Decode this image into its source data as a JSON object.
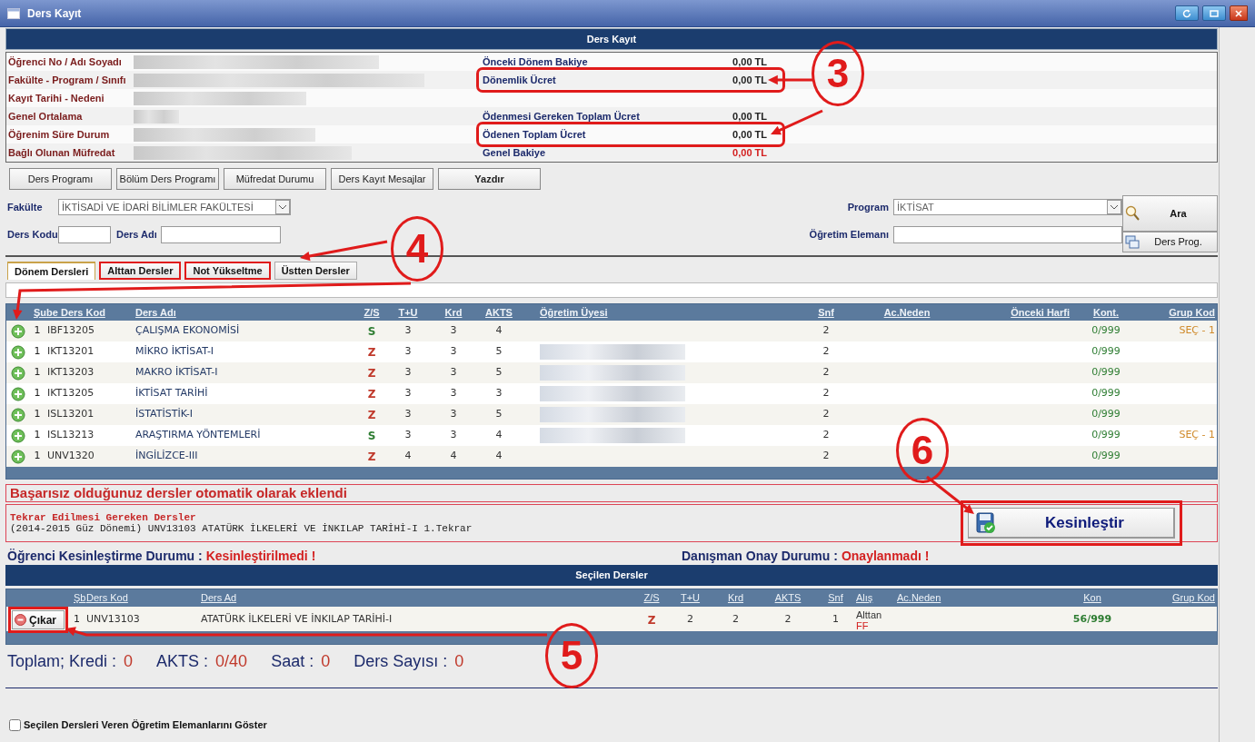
{
  "window": {
    "title": "Ders Kayıt"
  },
  "header": {
    "title": "Ders Kayıt"
  },
  "student_info": [
    {
      "label": "Öğrenci No / Adı Soyadı",
      "summary": {
        "label": "Önceki Dönem Bakiye",
        "value": "0,00 TL",
        "kind": "normal",
        "highlighted": false
      }
    },
    {
      "label": "Fakülte - Program / Sınıfı",
      "summary": {
        "label": "Dönemlik Ücret",
        "value": "0,00 TL",
        "kind": "normal",
        "highlighted": true
      }
    },
    {
      "label": "Kayıt Tarihi - Nedeni"
    },
    {
      "label": "Genel Ortalama",
      "summary": {
        "label": "Ödenmesi Gereken Toplam Ücret",
        "value": "0,00 TL",
        "kind": "normal",
        "highlighted": false
      }
    },
    {
      "label": "Öğrenim Süre Durum",
      "summary": {
        "label": "Ödenen Toplam Ücret",
        "value": "0,00 TL",
        "kind": "normal",
        "highlighted": true
      }
    },
    {
      "label": "Bağlı Olunan Müfredat",
      "summary": {
        "label": "Genel Bakiye",
        "value": "0,00 TL",
        "kind": "balance",
        "highlighted": false
      }
    }
  ],
  "toolbar": [
    {
      "label": "Ders Programı",
      "bold": false
    },
    {
      "label": "Bölüm Ders Programı",
      "bold": false
    },
    {
      "label": "Müfredat Durumu",
      "bold": false
    },
    {
      "label": "Ders Kayıt Mesajlar",
      "bold": false
    },
    {
      "label": "Yazdır",
      "bold": true
    }
  ],
  "filters": {
    "faculty": {
      "label": "Fakülte",
      "value": "İKTİSADİ VE İDARİ BİLİMLER FAKÜLTESİ"
    },
    "course_code": {
      "label": "Ders Kodu"
    },
    "course_name": {
      "label": "Ders Adı"
    },
    "program": {
      "label": "Program",
      "value": "İKTİSAT"
    },
    "instructor": {
      "label": "Öğretim Elemanı"
    },
    "search_button": "Ara",
    "schedule_button": "Ders Prog."
  },
  "tabs": [
    {
      "label": "Dönem Dersleri",
      "selected": true,
      "highlighted": false
    },
    {
      "label": "Alttan Dersler",
      "selected": false,
      "highlighted": true
    },
    {
      "label": "Not Yükseltme",
      "selected": false,
      "highlighted": true
    },
    {
      "label": "Üstten Dersler",
      "selected": false,
      "highlighted": false
    }
  ],
  "course_table": {
    "columns": [
      "Şube Ders Kod",
      "Ders Adı",
      "Z/S",
      "T+U",
      "Krd",
      "AKTS",
      "Öğretim Üyesi",
      "Snf",
      "Ac.Neden",
      "Önceki Harfi",
      "Kont.",
      "Grup Kod"
    ],
    "rows": [
      {
        "section": "1",
        "code": "IBF13205",
        "name": "ÇALIŞMA EKONOMİSİ",
        "zs": "S",
        "color": "#2e7d32",
        "tu": "3",
        "krd": "3",
        "akts": "4",
        "instructor_redacted": false,
        "snf": "2",
        "quota": "0/999",
        "group": "SEÇ - 1"
      },
      {
        "section": "1",
        "code": "IKT13201",
        "name": "MİKRO İKTİSAT-I",
        "zs": "Z",
        "color": "#c0392b",
        "tu": "3",
        "krd": "3",
        "akts": "5",
        "instructor_redacted": true,
        "snf": "2",
        "quota": "0/999"
      },
      {
        "section": "1",
        "code": "IKT13203",
        "name": "MAKRO İKTİSAT-I",
        "zs": "Z",
        "color": "#c0392b",
        "tu": "3",
        "krd": "3",
        "akts": "5",
        "instructor_redacted": true,
        "snf": "2",
        "quota": "0/999"
      },
      {
        "section": "1",
        "code": "IKT13205",
        "name": "İKTİSAT TARİHİ",
        "zs": "Z",
        "color": "#c0392b",
        "tu": "3",
        "krd": "3",
        "akts": "3",
        "instructor_redacted": true,
        "snf": "2",
        "quota": "0/999"
      },
      {
        "section": "1",
        "code": "ISL13201",
        "name": "İSTATİSTİK-I",
        "zs": "Z",
        "color": "#c0392b",
        "tu": "3",
        "krd": "3",
        "akts": "5",
        "instructor_redacted": true,
        "snf": "2",
        "quota": "0/999"
      },
      {
        "section": "1",
        "code": "ISL13213",
        "name": "ARAŞTIRMA YÖNTEMLERİ",
        "zs": "S",
        "color": "#2e7d32",
        "tu": "3",
        "krd": "3",
        "akts": "4",
        "instructor_redacted": true,
        "snf": "2",
        "quota": "0/999",
        "group": "SEÇ - 1"
      },
      {
        "section": "1",
        "code": "UNV1320",
        "name": "İNGİLİZCE-III",
        "zs": "Z",
        "color": "#c0392b",
        "tu": "4",
        "krd": "4",
        "akts": "4",
        "instructor_redacted": false,
        "snf": "2",
        "quota": "0/999"
      }
    ]
  },
  "auto_added_message": "Başarısız olduğunuz dersler otomatik olarak eklendi",
  "repeat_box": {
    "title": "Tekrar Edilmesi Gereken Dersler",
    "lines": [
      "(2014-2015 Güz Dönemi) UNV13103 ATATÜRK İLKELERİ VE İNKILAP TARİHİ-I 1.Tekrar"
    ]
  },
  "confirm_button": {
    "label": "Kesinleştir",
    "highlighted": true
  },
  "status": [
    {
      "label": "Öğrenci Kesinleştirme Durumu :",
      "value": "Kesinleştirilmedi !"
    },
    {
      "label": "Danışman Onay Durumu :",
      "value": "Onaylanmadı !"
    }
  ],
  "selected_courses": {
    "title": "Seçilen Dersler",
    "columns": [
      "Şb",
      "Ders Kod",
      "Ders Ad",
      "Z/S",
      "T+U",
      "Krd",
      "AKTS",
      "Snf",
      "Alış",
      "Ac.Neden",
      "Kon",
      "Grup Kod"
    ],
    "rows": [
      {
        "remove_button": "Çıkar",
        "highlighted": true,
        "section": "1",
        "code": "UNV13103",
        "name": "ATATÜRK İLKELERİ VE İNKILAP TARİHİ-I",
        "zs": "Z",
        "color": "#c0392b",
        "tu": "2",
        "krd": "2",
        "akts": "2",
        "snf": "1",
        "alis": "Alttan",
        "grade": "FF",
        "quota": "56/999"
      }
    ]
  },
  "totals": [
    {
      "label": "Toplam; Kredi :",
      "value": "0"
    },
    {
      "label": "AKTS :",
      "value": "0/40"
    },
    {
      "label": "Saat :",
      "value": "0"
    },
    {
      "label": "Ders Sayısı :",
      "value": "0"
    }
  ],
  "show_instructors": {
    "label": "Seçilen Dersleri Veren Öğretim Elemanlarını Göster",
    "checked": false
  },
  "annotations": [
    {
      "label": "3"
    },
    {
      "label": "4"
    },
    {
      "label": "5"
    },
    {
      "label": "6"
    }
  ]
}
